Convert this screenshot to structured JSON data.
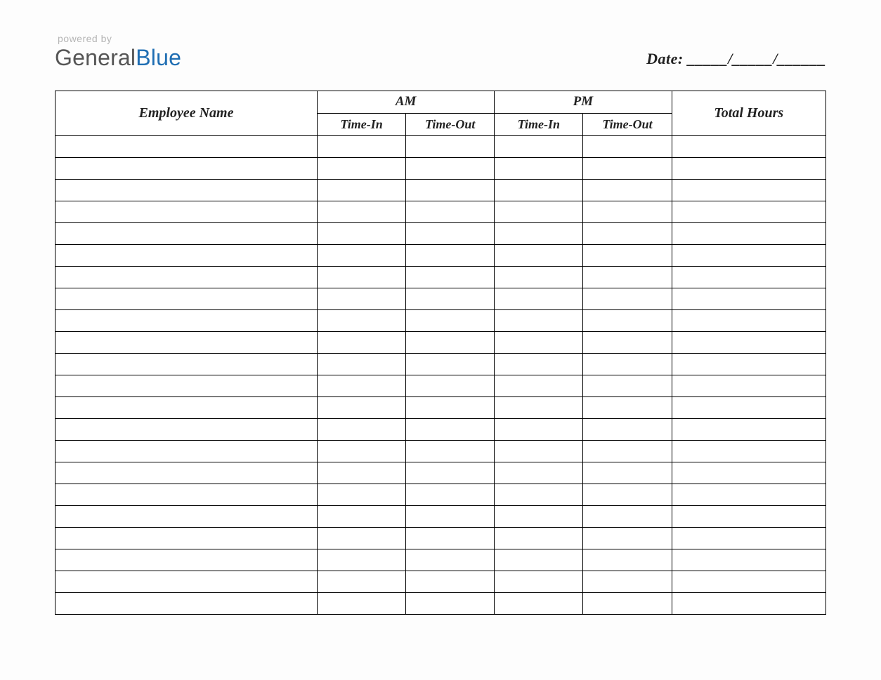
{
  "header": {
    "powered_by": "powered by",
    "brand_part1": "General",
    "brand_part2": "Blue",
    "date_label": "Date: _____/_____/______"
  },
  "table": {
    "columns": {
      "employee_name": "Employee Name",
      "am": "AM",
      "pm": "PM",
      "time_in": "Time-In",
      "time_out": "Time-Out",
      "total_hours": "Total Hours"
    },
    "rows": [
      {
        "employee_name": "",
        "am_time_in": "",
        "am_time_out": "",
        "pm_time_in": "",
        "pm_time_out": "",
        "total_hours": ""
      },
      {
        "employee_name": "",
        "am_time_in": "",
        "am_time_out": "",
        "pm_time_in": "",
        "pm_time_out": "",
        "total_hours": ""
      },
      {
        "employee_name": "",
        "am_time_in": "",
        "am_time_out": "",
        "pm_time_in": "",
        "pm_time_out": "",
        "total_hours": ""
      },
      {
        "employee_name": "",
        "am_time_in": "",
        "am_time_out": "",
        "pm_time_in": "",
        "pm_time_out": "",
        "total_hours": ""
      },
      {
        "employee_name": "",
        "am_time_in": "",
        "am_time_out": "",
        "pm_time_in": "",
        "pm_time_out": "",
        "total_hours": ""
      },
      {
        "employee_name": "",
        "am_time_in": "",
        "am_time_out": "",
        "pm_time_in": "",
        "pm_time_out": "",
        "total_hours": ""
      },
      {
        "employee_name": "",
        "am_time_in": "",
        "am_time_out": "",
        "pm_time_in": "",
        "pm_time_out": "",
        "total_hours": ""
      },
      {
        "employee_name": "",
        "am_time_in": "",
        "am_time_out": "",
        "pm_time_in": "",
        "pm_time_out": "",
        "total_hours": ""
      },
      {
        "employee_name": "",
        "am_time_in": "",
        "am_time_out": "",
        "pm_time_in": "",
        "pm_time_out": "",
        "total_hours": ""
      },
      {
        "employee_name": "",
        "am_time_in": "",
        "am_time_out": "",
        "pm_time_in": "",
        "pm_time_out": "",
        "total_hours": ""
      },
      {
        "employee_name": "",
        "am_time_in": "",
        "am_time_out": "",
        "pm_time_in": "",
        "pm_time_out": "",
        "total_hours": ""
      },
      {
        "employee_name": "",
        "am_time_in": "",
        "am_time_out": "",
        "pm_time_in": "",
        "pm_time_out": "",
        "total_hours": ""
      },
      {
        "employee_name": "",
        "am_time_in": "",
        "am_time_out": "",
        "pm_time_in": "",
        "pm_time_out": "",
        "total_hours": ""
      },
      {
        "employee_name": "",
        "am_time_in": "",
        "am_time_out": "",
        "pm_time_in": "",
        "pm_time_out": "",
        "total_hours": ""
      },
      {
        "employee_name": "",
        "am_time_in": "",
        "am_time_out": "",
        "pm_time_in": "",
        "pm_time_out": "",
        "total_hours": ""
      },
      {
        "employee_name": "",
        "am_time_in": "",
        "am_time_out": "",
        "pm_time_in": "",
        "pm_time_out": "",
        "total_hours": ""
      },
      {
        "employee_name": "",
        "am_time_in": "",
        "am_time_out": "",
        "pm_time_in": "",
        "pm_time_out": "",
        "total_hours": ""
      },
      {
        "employee_name": "",
        "am_time_in": "",
        "am_time_out": "",
        "pm_time_in": "",
        "pm_time_out": "",
        "total_hours": ""
      },
      {
        "employee_name": "",
        "am_time_in": "",
        "am_time_out": "",
        "pm_time_in": "",
        "pm_time_out": "",
        "total_hours": ""
      },
      {
        "employee_name": "",
        "am_time_in": "",
        "am_time_out": "",
        "pm_time_in": "",
        "pm_time_out": "",
        "total_hours": ""
      },
      {
        "employee_name": "",
        "am_time_in": "",
        "am_time_out": "",
        "pm_time_in": "",
        "pm_time_out": "",
        "total_hours": ""
      },
      {
        "employee_name": "",
        "am_time_in": "",
        "am_time_out": "",
        "pm_time_in": "",
        "pm_time_out": "",
        "total_hours": ""
      }
    ]
  }
}
